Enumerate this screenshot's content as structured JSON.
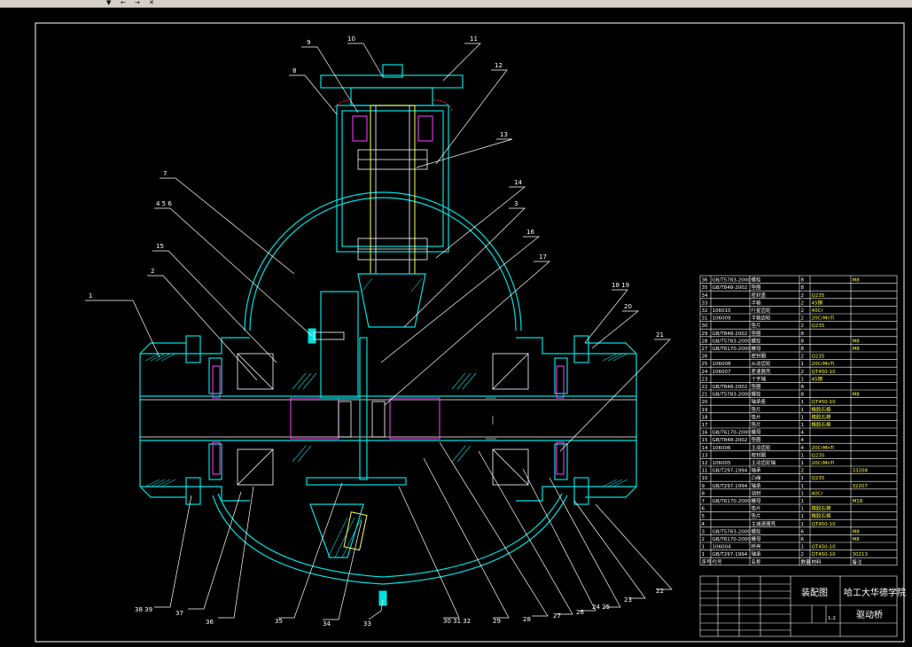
{
  "toolbar": {
    "buttons": [
      "▼",
      "←",
      "→",
      "✕"
    ]
  },
  "colors": {
    "background": "#000000",
    "outline": "#00e0e0",
    "leader": "#ffffff",
    "seal": "#ff3030",
    "shaft": "#ffff40",
    "bearing": "#ff40ff"
  },
  "callouts": {
    "top": [
      "9",
      "10",
      "11",
      "8",
      "12",
      "13",
      "7",
      "4 5 6",
      "14",
      "15",
      "3",
      "16",
      "17",
      "2",
      "18 19",
      "1",
      "20",
      "21"
    ],
    "bottom": [
      "38 39",
      "37",
      "36",
      "35",
      "34",
      "33",
      "30 31 32",
      "29",
      "28",
      "27",
      "26",
      "24 25",
      "23",
      "22"
    ]
  },
  "title_block": {
    "drawing_name": "装配图",
    "school": "哈工大华德学院",
    "part_name": "驱动桥",
    "scale": "1:2"
  },
  "parts_list": [
    {
      "no": "36",
      "code": "GB/T5783-2000",
      "name": "螺栓",
      "qty": "8",
      "material": "",
      "note": "M8"
    },
    {
      "no": "35",
      "code": "GB/T848-2002",
      "name": "垫圈",
      "qty": "8",
      "material": "",
      "note": ""
    },
    {
      "no": "34",
      "code": "",
      "name": "密封盖",
      "qty": "2",
      "material": "Q235",
      "note": ""
    },
    {
      "no": "33",
      "code": "",
      "name": "半轴",
      "qty": "2",
      "material": "45钢",
      "note": ""
    },
    {
      "no": "32",
      "code": "106010",
      "name": "行星齿轮",
      "qty": "2",
      "material": "40Cr",
      "note": ""
    },
    {
      "no": "31",
      "code": "106009",
      "name": "半轴齿轮",
      "qty": "2",
      "material": "20CrMnTi",
      "note": ""
    },
    {
      "no": "30",
      "code": "",
      "name": "垫片",
      "qty": "2",
      "material": "Q235",
      "note": ""
    },
    {
      "no": "29",
      "code": "GB/T848-2002",
      "name": "垫圈",
      "qty": "8",
      "material": "",
      "note": ""
    },
    {
      "no": "28",
      "code": "GB/T5783-2000",
      "name": "螺栓",
      "qty": "8",
      "material": "",
      "note": "M8"
    },
    {
      "no": "27",
      "code": "GB/T6170-2000",
      "name": "螺母",
      "qty": "8",
      "material": "",
      "note": "M8"
    },
    {
      "no": "26",
      "code": "",
      "name": "密封圈",
      "qty": "2",
      "material": "Q235",
      "note": ""
    },
    {
      "no": "25",
      "code": "106008",
      "name": "从动齿轮",
      "qty": "1",
      "material": "20CrMnTi",
      "note": ""
    },
    {
      "no": "24",
      "code": "106007",
      "name": "差速器壳",
      "qty": "2",
      "material": "QT450-10",
      "note": ""
    },
    {
      "no": "23",
      "code": "",
      "name": "十字轴",
      "qty": "1",
      "material": "45钢",
      "note": ""
    },
    {
      "no": "22",
      "code": "GB/T848-2002",
      "name": "垫圈",
      "qty": "8",
      "material": "",
      "note": ""
    },
    {
      "no": "21",
      "code": "GB/T5783-2000",
      "name": "螺栓",
      "qty": "8",
      "material": "",
      "note": "M8"
    },
    {
      "no": "20",
      "code": "",
      "name": "轴承座",
      "qty": "1",
      "material": "QT450-10",
      "note": ""
    },
    {
      "no": "19",
      "code": "",
      "name": "垫片",
      "qty": "1",
      "material": "橡胶石棉",
      "note": ""
    },
    {
      "no": "18",
      "code": "",
      "name": "垫片",
      "qty": "1",
      "material": "橡胶石棉",
      "note": ""
    },
    {
      "no": "17",
      "code": "",
      "name": "垫片",
      "qty": "1",
      "material": "橡胶石棉",
      "note": ""
    },
    {
      "no": "16",
      "code": "GB/T6170-2000",
      "name": "螺母",
      "qty": "4",
      "material": "",
      "note": ""
    },
    {
      "no": "15",
      "code": "GB/T848-2002",
      "name": "垫圈",
      "qty": "4",
      "material": "",
      "note": ""
    },
    {
      "no": "14",
      "code": "106006",
      "name": "主动齿轮",
      "qty": "4",
      "material": "20CrMnTi",
      "note": ""
    },
    {
      "no": "13",
      "code": "",
      "name": "密封圈",
      "qty": "1",
      "material": "Q235",
      "note": ""
    },
    {
      "no": "12",
      "code": "106005",
      "name": "主动齿轮轴",
      "qty": "1",
      "material": "20CrMnTi",
      "note": ""
    },
    {
      "no": "11",
      "code": "GB/T297-1994",
      "name": "轴承",
      "qty": "2",
      "material": "",
      "note": "33208"
    },
    {
      "no": "10",
      "code": "",
      "name": "凸缘",
      "qty": "1",
      "material": "Q235",
      "note": ""
    },
    {
      "no": "9",
      "code": "GB/T297-1994",
      "name": "轴承",
      "qty": "1",
      "material": "",
      "note": "32207"
    },
    {
      "no": "8",
      "code": "",
      "name": "油封",
      "qty": "1",
      "material": "40Cr",
      "note": ""
    },
    {
      "no": "7",
      "code": "GB/T6170-2000",
      "name": "螺母",
      "qty": "1",
      "material": "",
      "note": "M18"
    },
    {
      "no": "6",
      "code": "",
      "name": "垫片",
      "qty": "1",
      "material": "橡胶石棉",
      "note": ""
    },
    {
      "no": "5",
      "code": "",
      "name": "垫片",
      "qty": "1",
      "material": "橡胶石棉",
      "note": ""
    },
    {
      "no": "4",
      "code": "",
      "name": "主减速器壳",
      "qty": "1",
      "material": "QT450-10",
      "note": ""
    },
    {
      "no": "3",
      "code": "GB/T5783-2000",
      "name": "螺栓",
      "qty": "6",
      "material": "",
      "note": "M8"
    },
    {
      "no": "2",
      "code": "GB/T6170-2000",
      "name": "螺母",
      "qty": "6",
      "material": "",
      "note": "M8"
    },
    {
      "no": "1",
      "code": "106004",
      "name": "桥壳",
      "qty": "1",
      "material": "QT450-10",
      "note": ""
    },
    {
      "no": "1",
      "code": "GB/T297-1994",
      "name": "轴承",
      "qty": "2",
      "material": "QT450-10",
      "note": "30213"
    }
  ],
  "parts_header": {
    "no": "序号",
    "code": "代号",
    "name": "名称",
    "qty": "数量",
    "material": "材料",
    "note": "备注"
  }
}
